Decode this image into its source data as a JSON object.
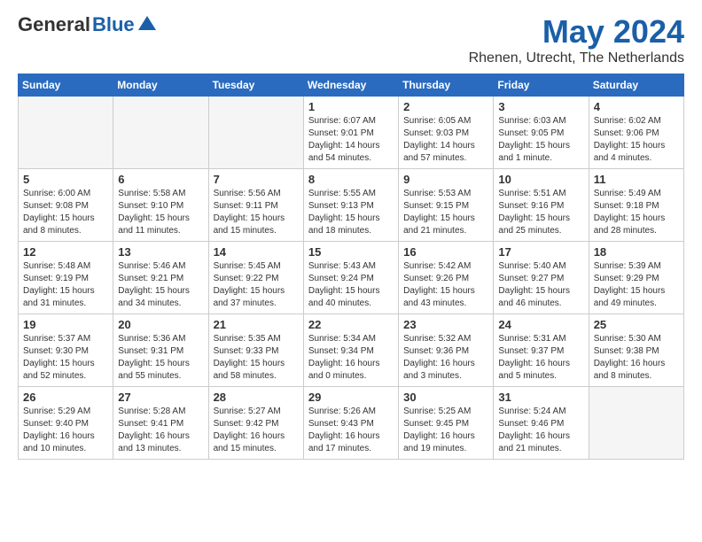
{
  "header": {
    "logo_general": "General",
    "logo_blue": "Blue",
    "month_title": "May 2024",
    "location": "Rhenen, Utrecht, The Netherlands"
  },
  "weekdays": [
    "Sunday",
    "Monday",
    "Tuesday",
    "Wednesday",
    "Thursday",
    "Friday",
    "Saturday"
  ],
  "weeks": [
    [
      {
        "day": "",
        "info": "",
        "empty": true
      },
      {
        "day": "",
        "info": "",
        "empty": true
      },
      {
        "day": "",
        "info": "",
        "empty": true
      },
      {
        "day": "1",
        "info": "Sunrise: 6:07 AM\nSunset: 9:01 PM\nDaylight: 14 hours\nand 54 minutes."
      },
      {
        "day": "2",
        "info": "Sunrise: 6:05 AM\nSunset: 9:03 PM\nDaylight: 14 hours\nand 57 minutes."
      },
      {
        "day": "3",
        "info": "Sunrise: 6:03 AM\nSunset: 9:05 PM\nDaylight: 15 hours\nand 1 minute."
      },
      {
        "day": "4",
        "info": "Sunrise: 6:02 AM\nSunset: 9:06 PM\nDaylight: 15 hours\nand 4 minutes."
      }
    ],
    [
      {
        "day": "5",
        "info": "Sunrise: 6:00 AM\nSunset: 9:08 PM\nDaylight: 15 hours\nand 8 minutes."
      },
      {
        "day": "6",
        "info": "Sunrise: 5:58 AM\nSunset: 9:10 PM\nDaylight: 15 hours\nand 11 minutes."
      },
      {
        "day": "7",
        "info": "Sunrise: 5:56 AM\nSunset: 9:11 PM\nDaylight: 15 hours\nand 15 minutes."
      },
      {
        "day": "8",
        "info": "Sunrise: 5:55 AM\nSunset: 9:13 PM\nDaylight: 15 hours\nand 18 minutes."
      },
      {
        "day": "9",
        "info": "Sunrise: 5:53 AM\nSunset: 9:15 PM\nDaylight: 15 hours\nand 21 minutes."
      },
      {
        "day": "10",
        "info": "Sunrise: 5:51 AM\nSunset: 9:16 PM\nDaylight: 15 hours\nand 25 minutes."
      },
      {
        "day": "11",
        "info": "Sunrise: 5:49 AM\nSunset: 9:18 PM\nDaylight: 15 hours\nand 28 minutes."
      }
    ],
    [
      {
        "day": "12",
        "info": "Sunrise: 5:48 AM\nSunset: 9:19 PM\nDaylight: 15 hours\nand 31 minutes."
      },
      {
        "day": "13",
        "info": "Sunrise: 5:46 AM\nSunset: 9:21 PM\nDaylight: 15 hours\nand 34 minutes."
      },
      {
        "day": "14",
        "info": "Sunrise: 5:45 AM\nSunset: 9:22 PM\nDaylight: 15 hours\nand 37 minutes."
      },
      {
        "day": "15",
        "info": "Sunrise: 5:43 AM\nSunset: 9:24 PM\nDaylight: 15 hours\nand 40 minutes."
      },
      {
        "day": "16",
        "info": "Sunrise: 5:42 AM\nSunset: 9:26 PM\nDaylight: 15 hours\nand 43 minutes."
      },
      {
        "day": "17",
        "info": "Sunrise: 5:40 AM\nSunset: 9:27 PM\nDaylight: 15 hours\nand 46 minutes."
      },
      {
        "day": "18",
        "info": "Sunrise: 5:39 AM\nSunset: 9:29 PM\nDaylight: 15 hours\nand 49 minutes."
      }
    ],
    [
      {
        "day": "19",
        "info": "Sunrise: 5:37 AM\nSunset: 9:30 PM\nDaylight: 15 hours\nand 52 minutes."
      },
      {
        "day": "20",
        "info": "Sunrise: 5:36 AM\nSunset: 9:31 PM\nDaylight: 15 hours\nand 55 minutes."
      },
      {
        "day": "21",
        "info": "Sunrise: 5:35 AM\nSunset: 9:33 PM\nDaylight: 15 hours\nand 58 minutes."
      },
      {
        "day": "22",
        "info": "Sunrise: 5:34 AM\nSunset: 9:34 PM\nDaylight: 16 hours\nand 0 minutes."
      },
      {
        "day": "23",
        "info": "Sunrise: 5:32 AM\nSunset: 9:36 PM\nDaylight: 16 hours\nand 3 minutes."
      },
      {
        "day": "24",
        "info": "Sunrise: 5:31 AM\nSunset: 9:37 PM\nDaylight: 16 hours\nand 5 minutes."
      },
      {
        "day": "25",
        "info": "Sunrise: 5:30 AM\nSunset: 9:38 PM\nDaylight: 16 hours\nand 8 minutes."
      }
    ],
    [
      {
        "day": "26",
        "info": "Sunrise: 5:29 AM\nSunset: 9:40 PM\nDaylight: 16 hours\nand 10 minutes."
      },
      {
        "day": "27",
        "info": "Sunrise: 5:28 AM\nSunset: 9:41 PM\nDaylight: 16 hours\nand 13 minutes."
      },
      {
        "day": "28",
        "info": "Sunrise: 5:27 AM\nSunset: 9:42 PM\nDaylight: 16 hours\nand 15 minutes."
      },
      {
        "day": "29",
        "info": "Sunrise: 5:26 AM\nSunset: 9:43 PM\nDaylight: 16 hours\nand 17 minutes."
      },
      {
        "day": "30",
        "info": "Sunrise: 5:25 AM\nSunset: 9:45 PM\nDaylight: 16 hours\nand 19 minutes."
      },
      {
        "day": "31",
        "info": "Sunrise: 5:24 AM\nSunset: 9:46 PM\nDaylight: 16 hours\nand 21 minutes."
      },
      {
        "day": "",
        "info": "",
        "empty": true
      }
    ]
  ]
}
